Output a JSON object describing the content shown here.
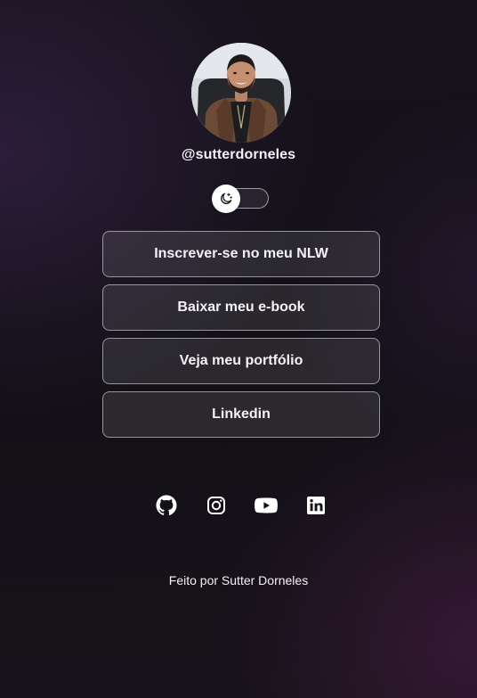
{
  "profile": {
    "username": "@sutterdorneles",
    "avatar_alt": "Sutter Dorneles"
  },
  "theme_toggle": {
    "icon": "moon-stars-icon",
    "state": "dark"
  },
  "links": [
    {
      "label": "Inscrever-se no meu NLW"
    },
    {
      "label": "Baixar meu e-book"
    },
    {
      "label": "Veja meu portfólio"
    },
    {
      "label": "Linkedin"
    }
  ],
  "social": [
    {
      "name": "github",
      "icon": "github-icon"
    },
    {
      "name": "instagram",
      "icon": "instagram-icon"
    },
    {
      "name": "youtube",
      "icon": "youtube-icon"
    },
    {
      "name": "linkedin",
      "icon": "linkedin-icon"
    }
  ],
  "footer": {
    "text": "Feito por Sutter Dorneles"
  },
  "colors": {
    "text": "#f4f1f7",
    "background": "#121016",
    "accent_glow": "#402856"
  }
}
